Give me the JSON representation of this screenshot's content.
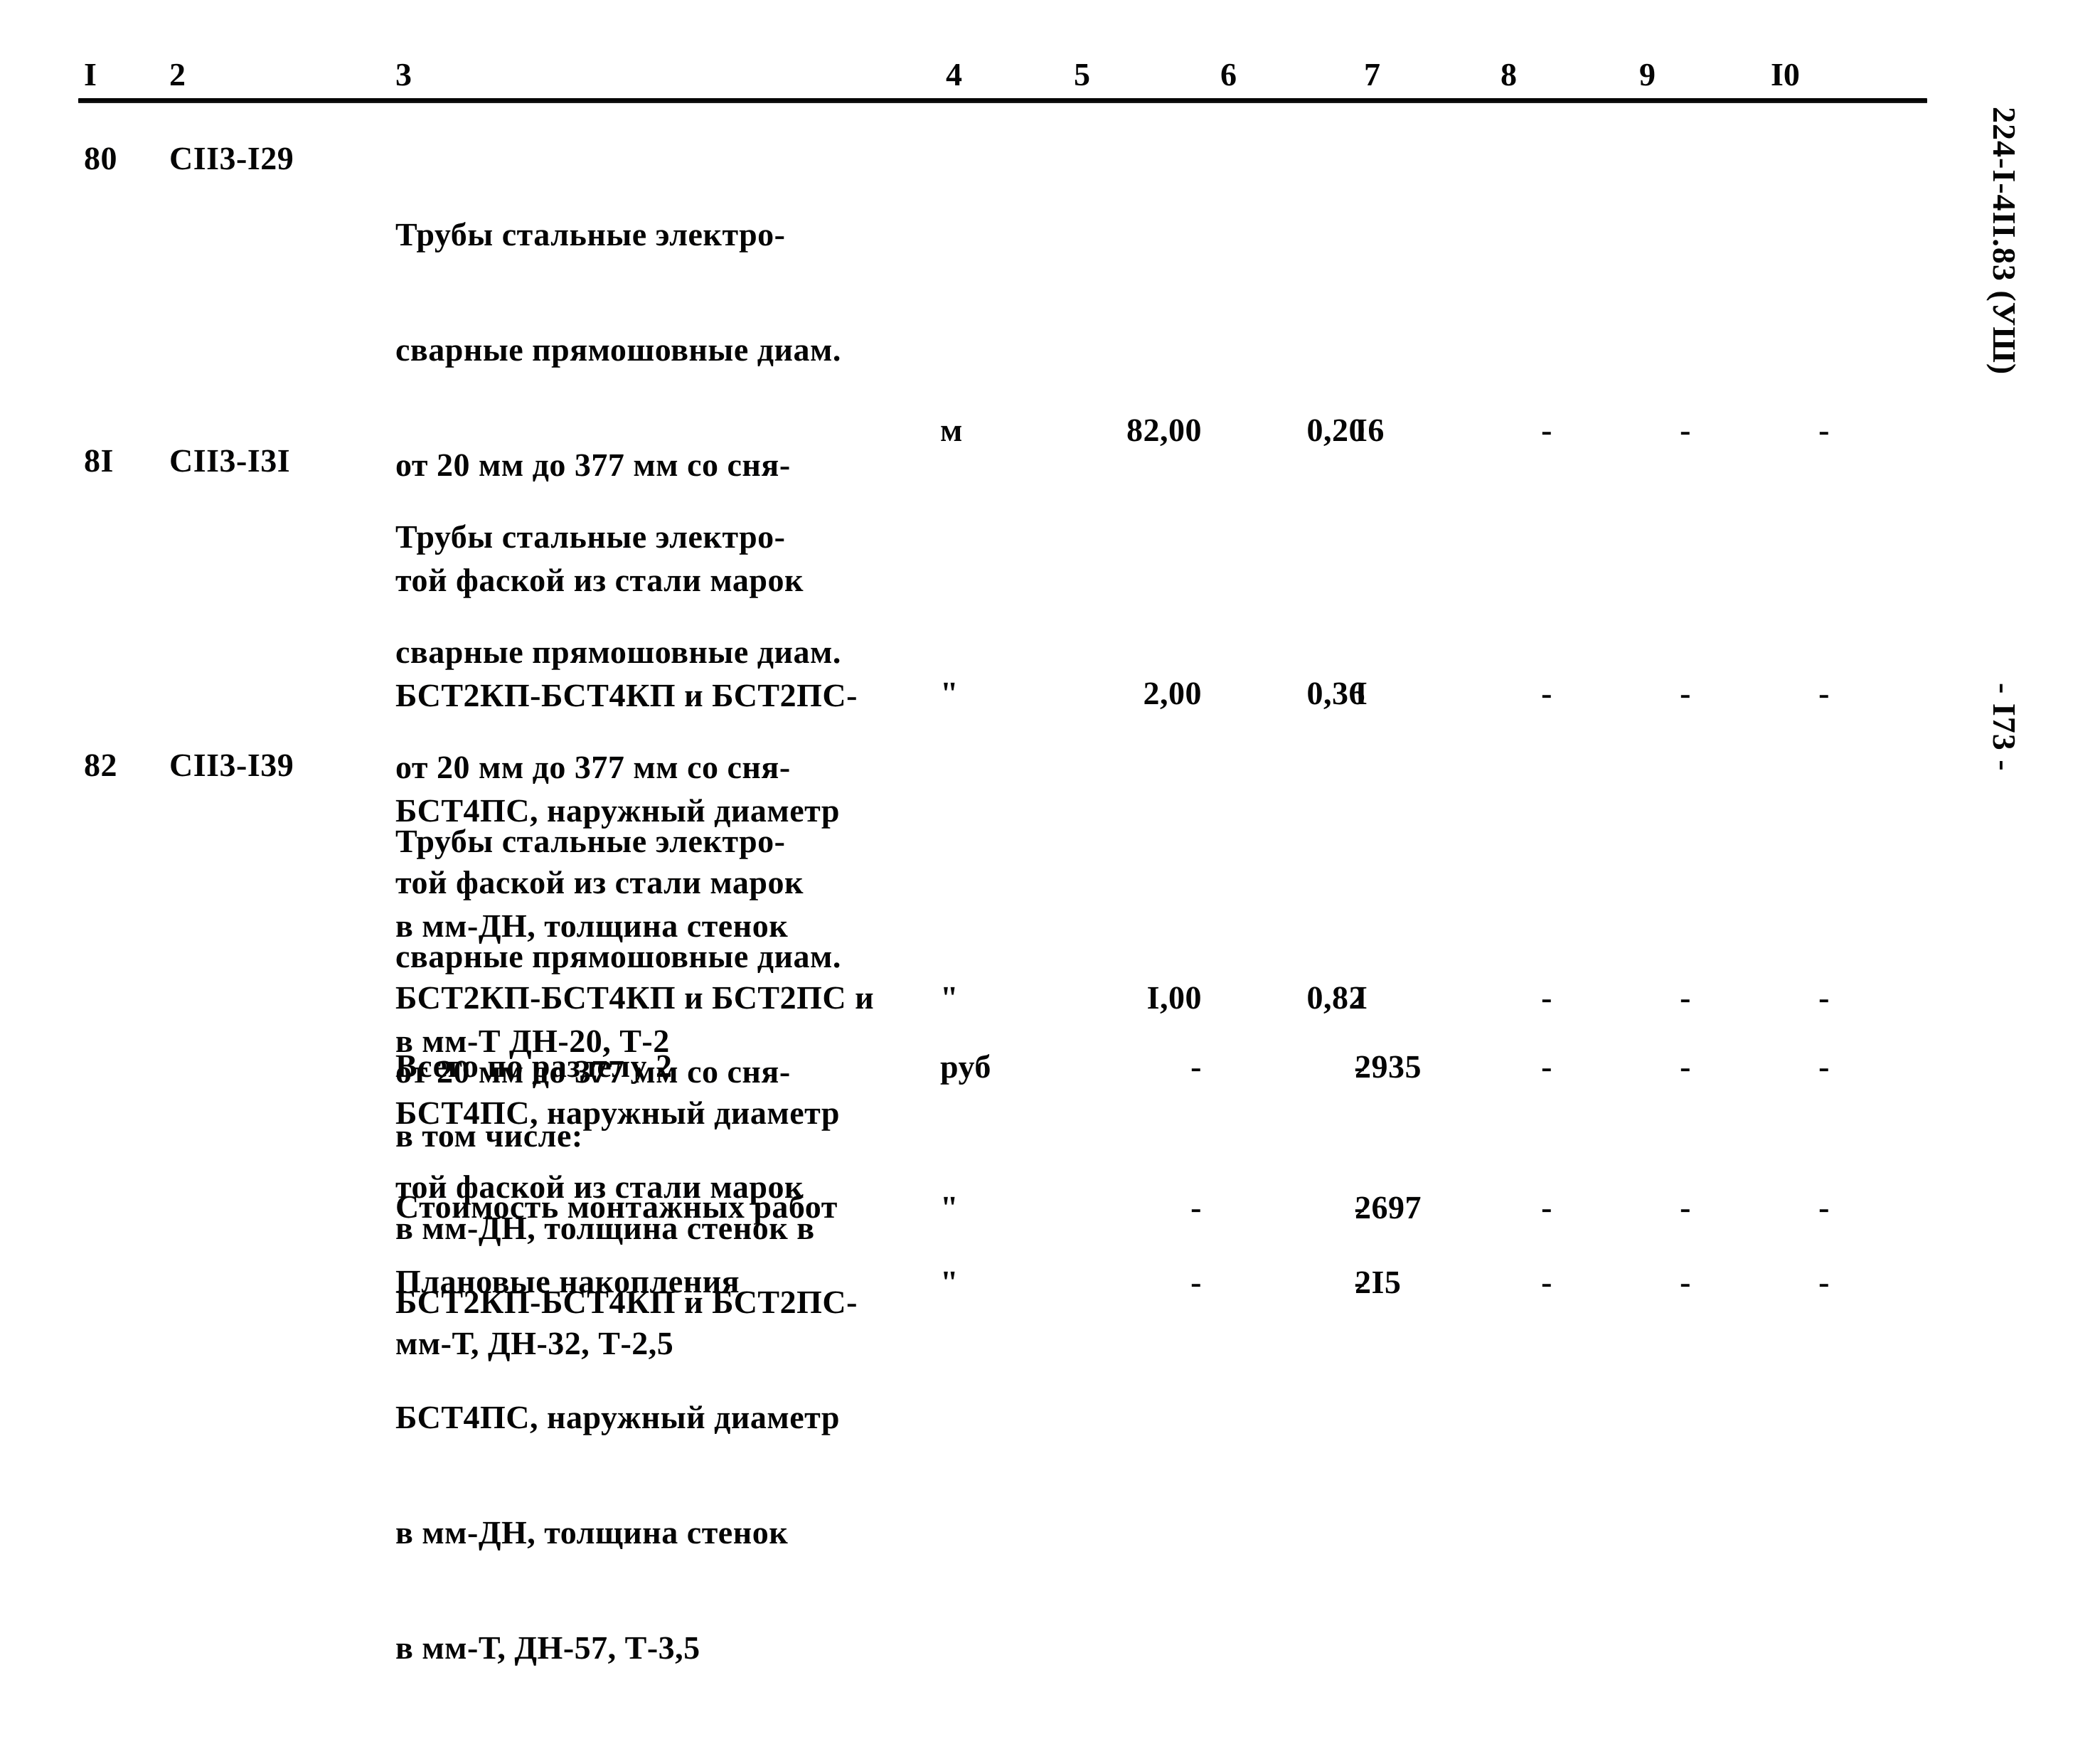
{
  "document": {
    "margin_code": "224-I-4II.83 (УШ)",
    "page_marker": "- I73 -"
  },
  "table": {
    "column_headers": [
      "I",
      "2",
      "3",
      "4",
      "5",
      "6",
      "7",
      "8",
      "9",
      "I0"
    ],
    "rows": [
      {
        "num": "80",
        "code": "СII3-I29",
        "description": [
          "Трубы стальные электро-",
          "сварные прямошовные диам.",
          "от 20 мм до 377 мм со сня-",
          "той фаской из стали марок",
          "БСТ2КП-БСТ4КП и БСТ2ПС-",
          "БСТ4ПС, наружный диаметр",
          "в мм-ДН, толщина стенок",
          "в мм-Т ДН-20, Т-2"
        ],
        "unit": "м",
        "col5": "82,00",
        "col6": "0,20",
        "col7": "I6",
        "col8": "-",
        "col9": "-",
        "col10": "-"
      },
      {
        "num": "8I",
        "code": "СII3-I3I",
        "description": [
          "Трубы стальные электро-",
          "сварные прямошовные диам.",
          "от 20 мм до 377 мм со сня-",
          "той фаской из стали марок",
          "БСТ2КП-БСТ4КП и БСТ2ПС и",
          "БСТ4ПС, наружный диаметр",
          "в мм-ДН, толщина стенок в",
          "мм-Т, ДН-32, Т-2,5"
        ],
        "unit": "\"",
        "col5": "2,00",
        "col6": "0,36",
        "col7": "I",
        "col8": "-",
        "col9": "-",
        "col10": "-"
      },
      {
        "num": "82",
        "code": "СII3-I39",
        "description": [
          "Трубы стальные электро-",
          "сварные прямошовные диам.",
          "от 20 мм до 377 мм со сня-",
          "той фаской из стали марок",
          "БСТ2КП-БСТ4КП и БСТ2ПС-",
          "БСТ4ПС, наружный диаметр",
          "в мм-ДН, толщина стенок",
          "в мм-Т, ДН-57, Т-3,5"
        ],
        "unit": "\"",
        "col5": "I,00",
        "col6": "0,82",
        "col7": "I",
        "col8": "-",
        "col9": "-",
        "col10": "-"
      }
    ],
    "summary_rows": [
      {
        "label": "Всего по разделу 2",
        "unit": "руб",
        "col5": "-",
        "col6": "-",
        "col7": "2935",
        "col8": "-",
        "col9": "-",
        "col10": "-"
      },
      {
        "label": "в том числе:",
        "unit": "",
        "col5": "",
        "col6": "",
        "col7": "",
        "col8": "",
        "col9": "",
        "col10": ""
      },
      {
        "label": "Стоимость монтажных работ",
        "unit": "\"",
        "col5": "-",
        "col6": "-",
        "col7": "2697",
        "col8": "-",
        "col9": "-",
        "col10": "-"
      },
      {
        "label": "Плановые накопления",
        "unit": "\"",
        "col5": "-",
        "col6": "-",
        "col7": "2I5",
        "col8": "-",
        "col9": "-",
        "col10": "-"
      }
    ]
  }
}
